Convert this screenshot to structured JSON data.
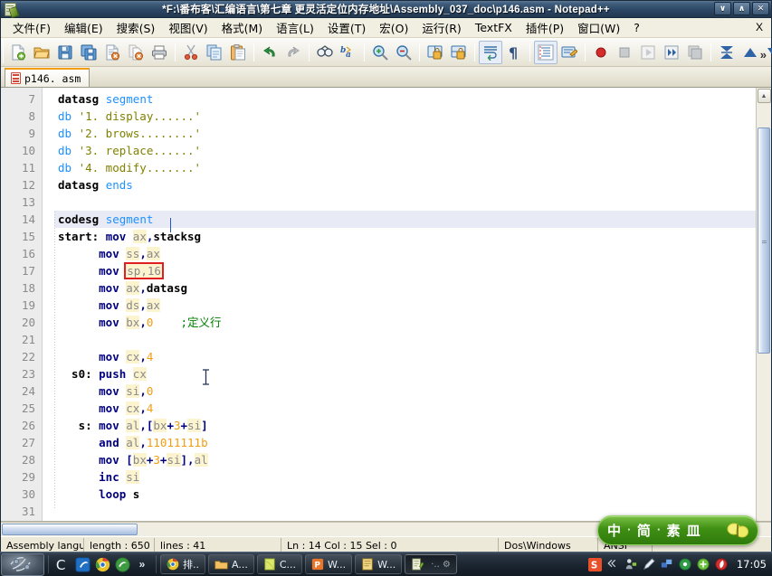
{
  "window": {
    "title": "*F:\\番布客\\汇编语言\\第七章 更灵活定位内存地址\\Assembly_037_doc\\p146.asm - Notepad++",
    "app_name": "Notepad++",
    "controls": {
      "minimize": "∨",
      "maximize": "∧",
      "close": "✕"
    }
  },
  "menubar": {
    "items": [
      {
        "label": "文件(F)",
        "name": "menu-file"
      },
      {
        "label": "编辑(E)",
        "name": "menu-edit"
      },
      {
        "label": "搜索(S)",
        "name": "menu-search"
      },
      {
        "label": "视图(V)",
        "name": "menu-view"
      },
      {
        "label": "格式(M)",
        "name": "menu-format"
      },
      {
        "label": "语言(L)",
        "name": "menu-language"
      },
      {
        "label": "设置(T)",
        "name": "menu-settings"
      },
      {
        "label": "宏(O)",
        "name": "menu-macro"
      },
      {
        "label": "运行(R)",
        "name": "menu-run"
      },
      {
        "label": "TextFX",
        "name": "menu-textfx"
      },
      {
        "label": "插件(P)",
        "name": "menu-plugins"
      },
      {
        "label": "窗口(W)",
        "name": "menu-window"
      },
      {
        "label": "?",
        "name": "menu-help"
      }
    ],
    "close_doc": "X"
  },
  "toolbar": {
    "overflow": "»",
    "buttons": [
      "new-file-icon",
      "open-file-icon",
      "save-icon",
      "save-all-icon",
      "close-file-icon",
      "close-all-icon",
      "print-icon",
      "cut-icon",
      "copy-icon",
      "paste-icon",
      "undo-icon",
      "redo-icon",
      "find-icon",
      "replace-icon",
      "zoom-in-icon",
      "zoom-out-icon",
      "sync-vertical-icon",
      "sync-horizontal-icon",
      "word-wrap-icon",
      "show-all-chars-icon",
      "indent-guide-icon",
      "user-defined-dialog-icon",
      "record-macro-icon",
      "stop-record-macro-icon",
      "play-macro-icon",
      "run-macro-multiple-icon",
      "save-macro-icon",
      "collapse-all-icon",
      "expand-up-icon",
      "expand-down-icon"
    ]
  },
  "tabs": [
    {
      "label": "p146. asm",
      "icon": "asm-file-icon",
      "active": true
    }
  ],
  "editor": {
    "first_line": 7,
    "caret_line": 14,
    "highlight_line": 14,
    "lines": [
      {
        "n": 7,
        "tokens": [
          {
            "t": "datasg ",
            "c": "lbl"
          },
          {
            "t": "segment",
            "c": "blu"
          }
        ]
      },
      {
        "n": 8,
        "tokens": [
          {
            "t": "db ",
            "c": "blu"
          },
          {
            "t": "'1. display......'",
            "c": "str"
          }
        ]
      },
      {
        "n": 9,
        "tokens": [
          {
            "t": "db ",
            "c": "blu"
          },
          {
            "t": "'2. brows........'",
            "c": "str"
          }
        ]
      },
      {
        "n": 10,
        "tokens": [
          {
            "t": "db ",
            "c": "blu"
          },
          {
            "t": "'3. replace......'",
            "c": "str"
          }
        ]
      },
      {
        "n": 11,
        "tokens": [
          {
            "t": "db ",
            "c": "blu"
          },
          {
            "t": "'4. modify.......'",
            "c": "str"
          }
        ]
      },
      {
        "n": 12,
        "tokens": [
          {
            "t": "datasg ",
            "c": "lbl"
          },
          {
            "t": "ends",
            "c": "blu"
          }
        ]
      },
      {
        "n": 13,
        "tokens": []
      },
      {
        "n": 14,
        "tokens": [
          {
            "t": "codesg ",
            "c": "lbl"
          },
          {
            "t": "segment",
            "c": "blu"
          }
        ]
      },
      {
        "n": 15,
        "tokens": [
          {
            "t": "start: ",
            "c": "lbl"
          },
          {
            "t": "mov ",
            "c": "instr"
          },
          {
            "t": "ax",
            "c": "reg"
          },
          {
            "t": ",",
            "c": "pun"
          },
          {
            "t": "stacksg",
            "c": "lbl"
          }
        ]
      },
      {
        "n": 16,
        "tokens": [
          {
            "t": "      ",
            "c": "pun"
          },
          {
            "t": "mov ",
            "c": "instr"
          },
          {
            "t": "ss",
            "c": "reg"
          },
          {
            "t": ",",
            "c": "pun"
          },
          {
            "t": "ax",
            "c": "reg"
          }
        ]
      },
      {
        "n": 17,
        "tokens": [
          {
            "t": "      ",
            "c": "pun"
          },
          {
            "t": "mov ",
            "c": "instr"
          },
          {
            "t": "sp,16",
            "c": "redbox-reg"
          }
        ]
      },
      {
        "n": 18,
        "tokens": [
          {
            "t": "      ",
            "c": "pun"
          },
          {
            "t": "mov ",
            "c": "instr"
          },
          {
            "t": "ax",
            "c": "reg"
          },
          {
            "t": ",",
            "c": "pun"
          },
          {
            "t": "datasg",
            "c": "lbl"
          }
        ]
      },
      {
        "n": 19,
        "tokens": [
          {
            "t": "      ",
            "c": "pun"
          },
          {
            "t": "mov ",
            "c": "instr"
          },
          {
            "t": "ds",
            "c": "reg"
          },
          {
            "t": ",",
            "c": "pun"
          },
          {
            "t": "ax",
            "c": "reg"
          }
        ]
      },
      {
        "n": 20,
        "tokens": [
          {
            "t": "      ",
            "c": "pun"
          },
          {
            "t": "mov ",
            "c": "instr"
          },
          {
            "t": "bx",
            "c": "reg"
          },
          {
            "t": ",",
            "c": "pun"
          },
          {
            "t": "0",
            "c": "num"
          },
          {
            "t": "    ",
            "c": "pun"
          },
          {
            "t": ";定义行",
            "c": "cmt"
          }
        ]
      },
      {
        "n": 21,
        "tokens": []
      },
      {
        "n": 22,
        "tokens": [
          {
            "t": "      ",
            "c": "pun"
          },
          {
            "t": "mov ",
            "c": "instr"
          },
          {
            "t": "cx",
            "c": "reg"
          },
          {
            "t": ",",
            "c": "pun"
          },
          {
            "t": "4",
            "c": "num"
          }
        ]
      },
      {
        "n": 23,
        "tokens": [
          {
            "t": "  s0: ",
            "c": "lbl"
          },
          {
            "t": "push ",
            "c": "instr"
          },
          {
            "t": "cx",
            "c": "reg"
          }
        ]
      },
      {
        "n": 24,
        "tokens": [
          {
            "t": "      ",
            "c": "pun"
          },
          {
            "t": "mov ",
            "c": "instr"
          },
          {
            "t": "si",
            "c": "reg"
          },
          {
            "t": ",",
            "c": "pun"
          },
          {
            "t": "0",
            "c": "num"
          }
        ]
      },
      {
        "n": 25,
        "tokens": [
          {
            "t": "      ",
            "c": "pun"
          },
          {
            "t": "mov ",
            "c": "instr"
          },
          {
            "t": "cx",
            "c": "reg"
          },
          {
            "t": ",",
            "c": "pun"
          },
          {
            "t": "4",
            "c": "num"
          }
        ]
      },
      {
        "n": 26,
        "tokens": [
          {
            "t": "   s: ",
            "c": "lbl"
          },
          {
            "t": "mov ",
            "c": "instr"
          },
          {
            "t": "al",
            "c": "reg"
          },
          {
            "t": ",[",
            "c": "pun"
          },
          {
            "t": "bx",
            "c": "reg"
          },
          {
            "t": "+",
            "c": "pun"
          },
          {
            "t": "3",
            "c": "num"
          },
          {
            "t": "+",
            "c": "pun"
          },
          {
            "t": "si",
            "c": "reg"
          },
          {
            "t": "]",
            "c": "pun"
          }
        ]
      },
      {
        "n": 27,
        "tokens": [
          {
            "t": "      ",
            "c": "pun"
          },
          {
            "t": "and ",
            "c": "instr"
          },
          {
            "t": "al",
            "c": "reg"
          },
          {
            "t": ",",
            "c": "pun"
          },
          {
            "t": "11011111b",
            "c": "num"
          }
        ]
      },
      {
        "n": 28,
        "tokens": [
          {
            "t": "      ",
            "c": "pun"
          },
          {
            "t": "mov ",
            "c": "instr"
          },
          {
            "t": "[",
            "c": "pun"
          },
          {
            "t": "bx",
            "c": "reg"
          },
          {
            "t": "+",
            "c": "pun"
          },
          {
            "t": "3",
            "c": "num"
          },
          {
            "t": "+",
            "c": "pun"
          },
          {
            "t": "si",
            "c": "reg"
          },
          {
            "t": "],",
            "c": "pun"
          },
          {
            "t": "al",
            "c": "reg"
          }
        ]
      },
      {
        "n": 29,
        "tokens": [
          {
            "t": "      ",
            "c": "pun"
          },
          {
            "t": "inc ",
            "c": "instr"
          },
          {
            "t": "si",
            "c": "reg"
          }
        ]
      },
      {
        "n": 30,
        "tokens": [
          {
            "t": "      ",
            "c": "pun"
          },
          {
            "t": "loop ",
            "c": "instr"
          },
          {
            "t": "s",
            "c": "lbl"
          }
        ]
      },
      {
        "n": 31,
        "tokens": []
      }
    ]
  },
  "statusbar": {
    "language": "Assembly language",
    "length_label": "length : 650",
    "lines_label": "lines : 41",
    "position": "Ln : 14   Col : 15   Sel : 0",
    "eol": "Dos\\Windows",
    "encoding": "ANSI",
    "mode": ""
  },
  "ime": {
    "mode": "中",
    "sep1": "·",
    "shape": "简",
    "sep2": "·",
    "punct": "素",
    "keyboard": "皿",
    "logo": "butterfly-icon"
  },
  "taskbar": {
    "start": "start-orb-icon",
    "quicklaunch": [
      "c-icon",
      "ie-icon",
      "chrome-icon",
      "browser-green-icon",
      "overflow-icon"
    ],
    "items": [
      {
        "label": "排..",
        "icon": "chrome-icon",
        "active": false
      },
      {
        "label": "A...",
        "icon": "folder-icon",
        "active": false
      },
      {
        "label": "C...",
        "icon": "notepad-green-icon",
        "active": false
      },
      {
        "label": "W...",
        "icon": "powerpoint-icon",
        "active": false
      },
      {
        "label": "W...",
        "icon": "word-icon",
        "active": false
      },
      {
        "label": "",
        "icon": "notepadpp-icon",
        "active": true
      }
    ],
    "tray": [
      "sogou-icon",
      "collapse-icon",
      "person-icon",
      "pen-icon",
      "network-icon",
      "disc-icon",
      "update-icon",
      "shield-icon"
    ],
    "clock": "17:05"
  },
  "colors": {
    "accent": "#f39c12",
    "titlebar": "#2c4765",
    "keyword": "#00008b",
    "string": "#808000",
    "comment": "#008000",
    "number": "#f39c12",
    "highlight_box": "#e02020",
    "ime_green": "#3f8f14"
  }
}
